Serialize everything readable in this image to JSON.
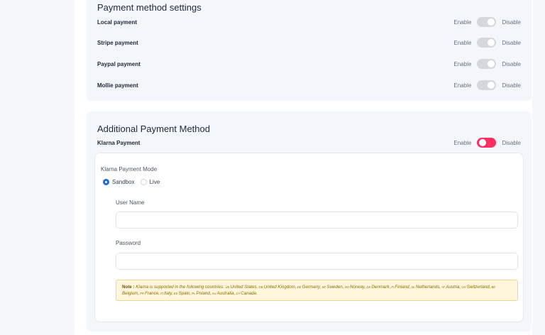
{
  "payment_settings": {
    "title": "Payment method settings",
    "enable_label": "Enable",
    "disable_label": "Disable",
    "methods": [
      {
        "label": "Local payment",
        "enabled": false
      },
      {
        "label": "Stripe payment",
        "enabled": false
      },
      {
        "label": "Paypal payment",
        "enabled": false
      },
      {
        "label": "Mollie payment",
        "enabled": false
      }
    ]
  },
  "additional": {
    "title": "Additional Payment Method",
    "method_label": "Klarna Payment",
    "enable_label": "Enable",
    "disable_label": "Disable",
    "enabled": true,
    "mode_label": "Klarna Payment Mode",
    "modes": [
      {
        "label": "Sandbox",
        "checked": true
      },
      {
        "label": "Live",
        "checked": false
      }
    ],
    "username_label": "User Name",
    "username_value": "",
    "password_label": "Password",
    "password_value": "",
    "note_prefix": "Note :",
    "note_intro": "Klarna is supported in the following countries:",
    "countries": [
      {
        "code": "US",
        "name": "United States"
      },
      {
        "code": "GB",
        "name": "United Kingdom"
      },
      {
        "code": "DE",
        "name": "Germany"
      },
      {
        "code": "SE",
        "name": "Sweden"
      },
      {
        "code": "NO",
        "name": "Norway"
      },
      {
        "code": "DK",
        "name": "Denmark"
      },
      {
        "code": "FI",
        "name": "Finland"
      },
      {
        "code": "NL",
        "name": "Netherlands"
      },
      {
        "code": "AT",
        "name": "Austria"
      },
      {
        "code": "CH",
        "name": "Switzerland"
      },
      {
        "code": "BE",
        "name": "Belgium"
      },
      {
        "code": "FR",
        "name": "France"
      },
      {
        "code": "IT",
        "name": "Italy"
      },
      {
        "code": "ES",
        "name": "Spain"
      },
      {
        "code": "PL",
        "name": "Poland"
      },
      {
        "code": "AU",
        "name": "Australia"
      },
      {
        "code": "CA",
        "name": "Canada"
      }
    ]
  },
  "colors": {
    "toggle_on": "#ff2e63",
    "toggle_off": "#d4d7dc",
    "radio_accent": "#1e6bd6",
    "note_bg": "#fff6dc"
  }
}
